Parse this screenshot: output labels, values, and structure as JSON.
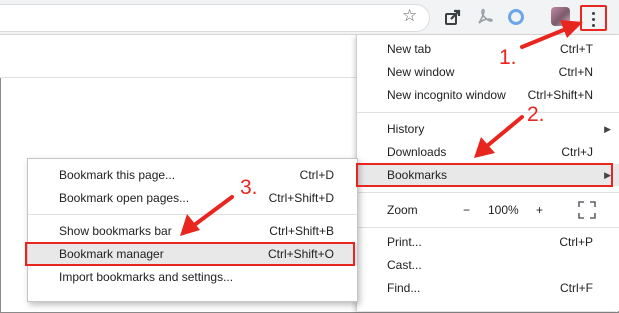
{
  "toolbar": {
    "icons": [
      "star-icon",
      "share-icon",
      "pdf-icon",
      "circle-extension-icon",
      "profile-avatar",
      "more-vert-icon"
    ]
  },
  "main_menu": {
    "new_tab": {
      "label": "New tab",
      "shortcut": "Ctrl+T"
    },
    "new_window": {
      "label": "New window",
      "shortcut": "Ctrl+N"
    },
    "new_incognito": {
      "label": "New incognito window",
      "shortcut": "Ctrl+Shift+N"
    },
    "history": {
      "label": "History"
    },
    "downloads": {
      "label": "Downloads",
      "shortcut": "Ctrl+J"
    },
    "bookmarks": {
      "label": "Bookmarks"
    },
    "zoom": {
      "label": "Zoom",
      "minus": "−",
      "value": "100%",
      "plus": "+"
    },
    "print": {
      "label": "Print...",
      "shortcut": "Ctrl+P"
    },
    "cast": {
      "label": "Cast..."
    },
    "find": {
      "label": "Find...",
      "shortcut": "Ctrl+F"
    }
  },
  "bookmarks_menu": {
    "bookmark_page": {
      "label": "Bookmark this page...",
      "shortcut": "Ctrl+D"
    },
    "bookmark_open": {
      "label": "Bookmark open pages...",
      "shortcut": "Ctrl+Shift+D"
    },
    "show_bar": {
      "label": "Show bookmarks bar",
      "shortcut": "Ctrl+Shift+B"
    },
    "manager": {
      "label": "Bookmark manager",
      "shortcut": "Ctrl+Shift+O"
    },
    "import": {
      "label": "Import bookmarks and settings..."
    }
  },
  "annotations": {
    "step1": "1.",
    "step2": "2.",
    "step3": "3."
  },
  "colors": {
    "annotation": "#e8261f",
    "highlight_row": "#e8e8e8"
  }
}
